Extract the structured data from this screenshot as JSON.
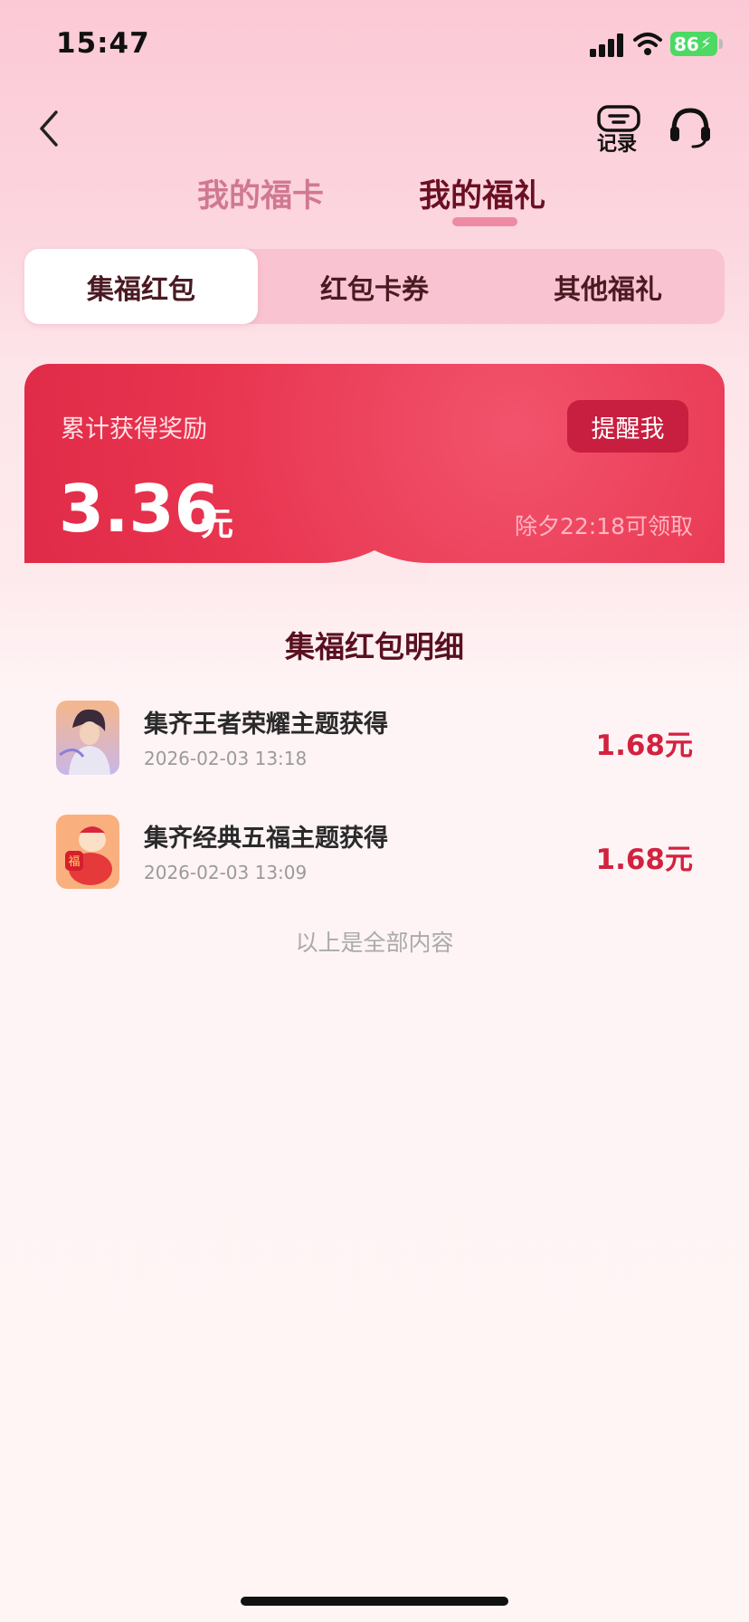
{
  "status_bar": {
    "time": "15:47",
    "battery": "86"
  },
  "header": {
    "record_label": "记录",
    "tabs": [
      {
        "label": "我的福卡",
        "active": false
      },
      {
        "label": "我的福礼",
        "active": true
      }
    ]
  },
  "segments": [
    {
      "label": "集福红包",
      "active": true
    },
    {
      "label": "红包卡券",
      "active": false
    },
    {
      "label": "其他福礼",
      "active": false
    }
  ],
  "reward": {
    "label": "累计获得奖励",
    "remind_button": "提醒我",
    "amount": "3.36",
    "unit": "元",
    "note": "除夕22:18可领取"
  },
  "detail": {
    "title": "集福红包明细",
    "items": [
      {
        "title": "集齐王者荣耀主题获得",
        "time": "2026-02-03 13:18",
        "amount": "1.68元",
        "thumb_icon": "game-character-thumb"
      },
      {
        "title": "集齐经典五福主题获得",
        "time": "2026-02-03 13:09",
        "amount": "1.68元",
        "thumb_icon": "fu-mascot-thumb"
      }
    ],
    "end_text": "以上是全部内容"
  },
  "colors": {
    "accent": "#e8344f",
    "amount": "#d2223f",
    "active_tab": "#6b0f22",
    "inactive_tab": "#d07892"
  }
}
